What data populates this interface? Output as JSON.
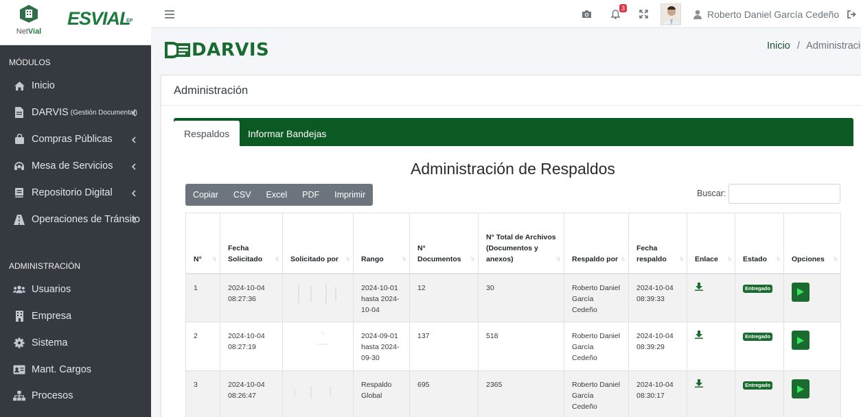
{
  "brand": {
    "netvial_prefix": "Net",
    "netvial_suffix": "Vial",
    "esvial": "ESVIAL",
    "esvial_suffix": "EP"
  },
  "sidebar": {
    "section_modules": "MÓDULOS",
    "section_admin": "ADMINISTRACIÓN",
    "modules": [
      {
        "label": "Inicio",
        "icon": "home-icon"
      },
      {
        "label": "DARVIS",
        "sublabel": "(Gestión Documental)",
        "icon": "document-icon"
      },
      {
        "label": "Compras Públicas",
        "icon": "shopping-bag-icon"
      },
      {
        "label": "Mesa de Servicios",
        "icon": "headset-icon"
      },
      {
        "label": "Repositorio Digital",
        "icon": "book-icon"
      },
      {
        "label": "Operaciones de Tránsito",
        "icon": "road-icon"
      }
    ],
    "admin": [
      {
        "label": "Usuarios",
        "icon": "users-icon"
      },
      {
        "label": "Empresa",
        "icon": "building-icon"
      },
      {
        "label": "Sistema",
        "icon": "gear-icon"
      },
      {
        "label": "Mant. Cargos",
        "icon": "id-card-icon"
      },
      {
        "label": "Procesos",
        "icon": "sitemap-icon"
      }
    ]
  },
  "topbar": {
    "notification_count": "3",
    "user_name": "Roberto Daniel García Cedeño"
  },
  "header": {
    "logo_text": "DARVIS",
    "breadcrumb_home": "Inicio",
    "breadcrumb_sep": "/",
    "breadcrumb_current": "Administración"
  },
  "card": {
    "title": "Administración",
    "tabs": [
      {
        "label": "Respaldos"
      },
      {
        "label": "Informar Bandejas"
      }
    ],
    "section_title": "Administración de Respaldos",
    "export_buttons": [
      "Copiar",
      "CSV",
      "Excel",
      "PDF",
      "Imprimir"
    ],
    "search_label": "Buscar:",
    "search_value": ""
  },
  "table": {
    "headers": [
      "N°",
      "Fecha Solicitado",
      "Solicitado por",
      "Rango",
      "N° Documentos",
      "N° Total de Archivos (Documentos y anexos)",
      "Respaldo por",
      "Fecha respaldo",
      "Enlace",
      "Estado",
      "Opciones"
    ],
    "rows": [
      {
        "n": "1",
        "fecha": "2024-10-04 08:27:36",
        "rango": "2024-10-01 hasta 2024-10-04",
        "docs": "12",
        "total": "30",
        "por": "Roberto Daniel García Cedeño",
        "fecha_resp": "2024-10-04 08:39:33",
        "estado": "Entregado"
      },
      {
        "n": "2",
        "fecha": "2024-10-04 08:27:19",
        "rango": "2024-09-01 hasta 2024-09-30",
        "docs": "137",
        "total": "518",
        "por": "Roberto Daniel García Cedeño",
        "fecha_resp": "2024-10-04 08:39:29",
        "estado": "Entregado"
      },
      {
        "n": "3",
        "fecha": "2024-10-04 08:26:47",
        "rango": "Respaldo Global",
        "docs": "695",
        "total": "2365",
        "por": "Roberto Daniel García Cedeño",
        "fecha_resp": "2024-10-04 08:30:17",
        "estado": "Entregado"
      }
    ]
  },
  "colors": {
    "primary_green": "#1a6b2f",
    "tabbar_green": "#0b5a24",
    "sidebar_bg": "#343a40",
    "badge_red": "#dc3545"
  }
}
